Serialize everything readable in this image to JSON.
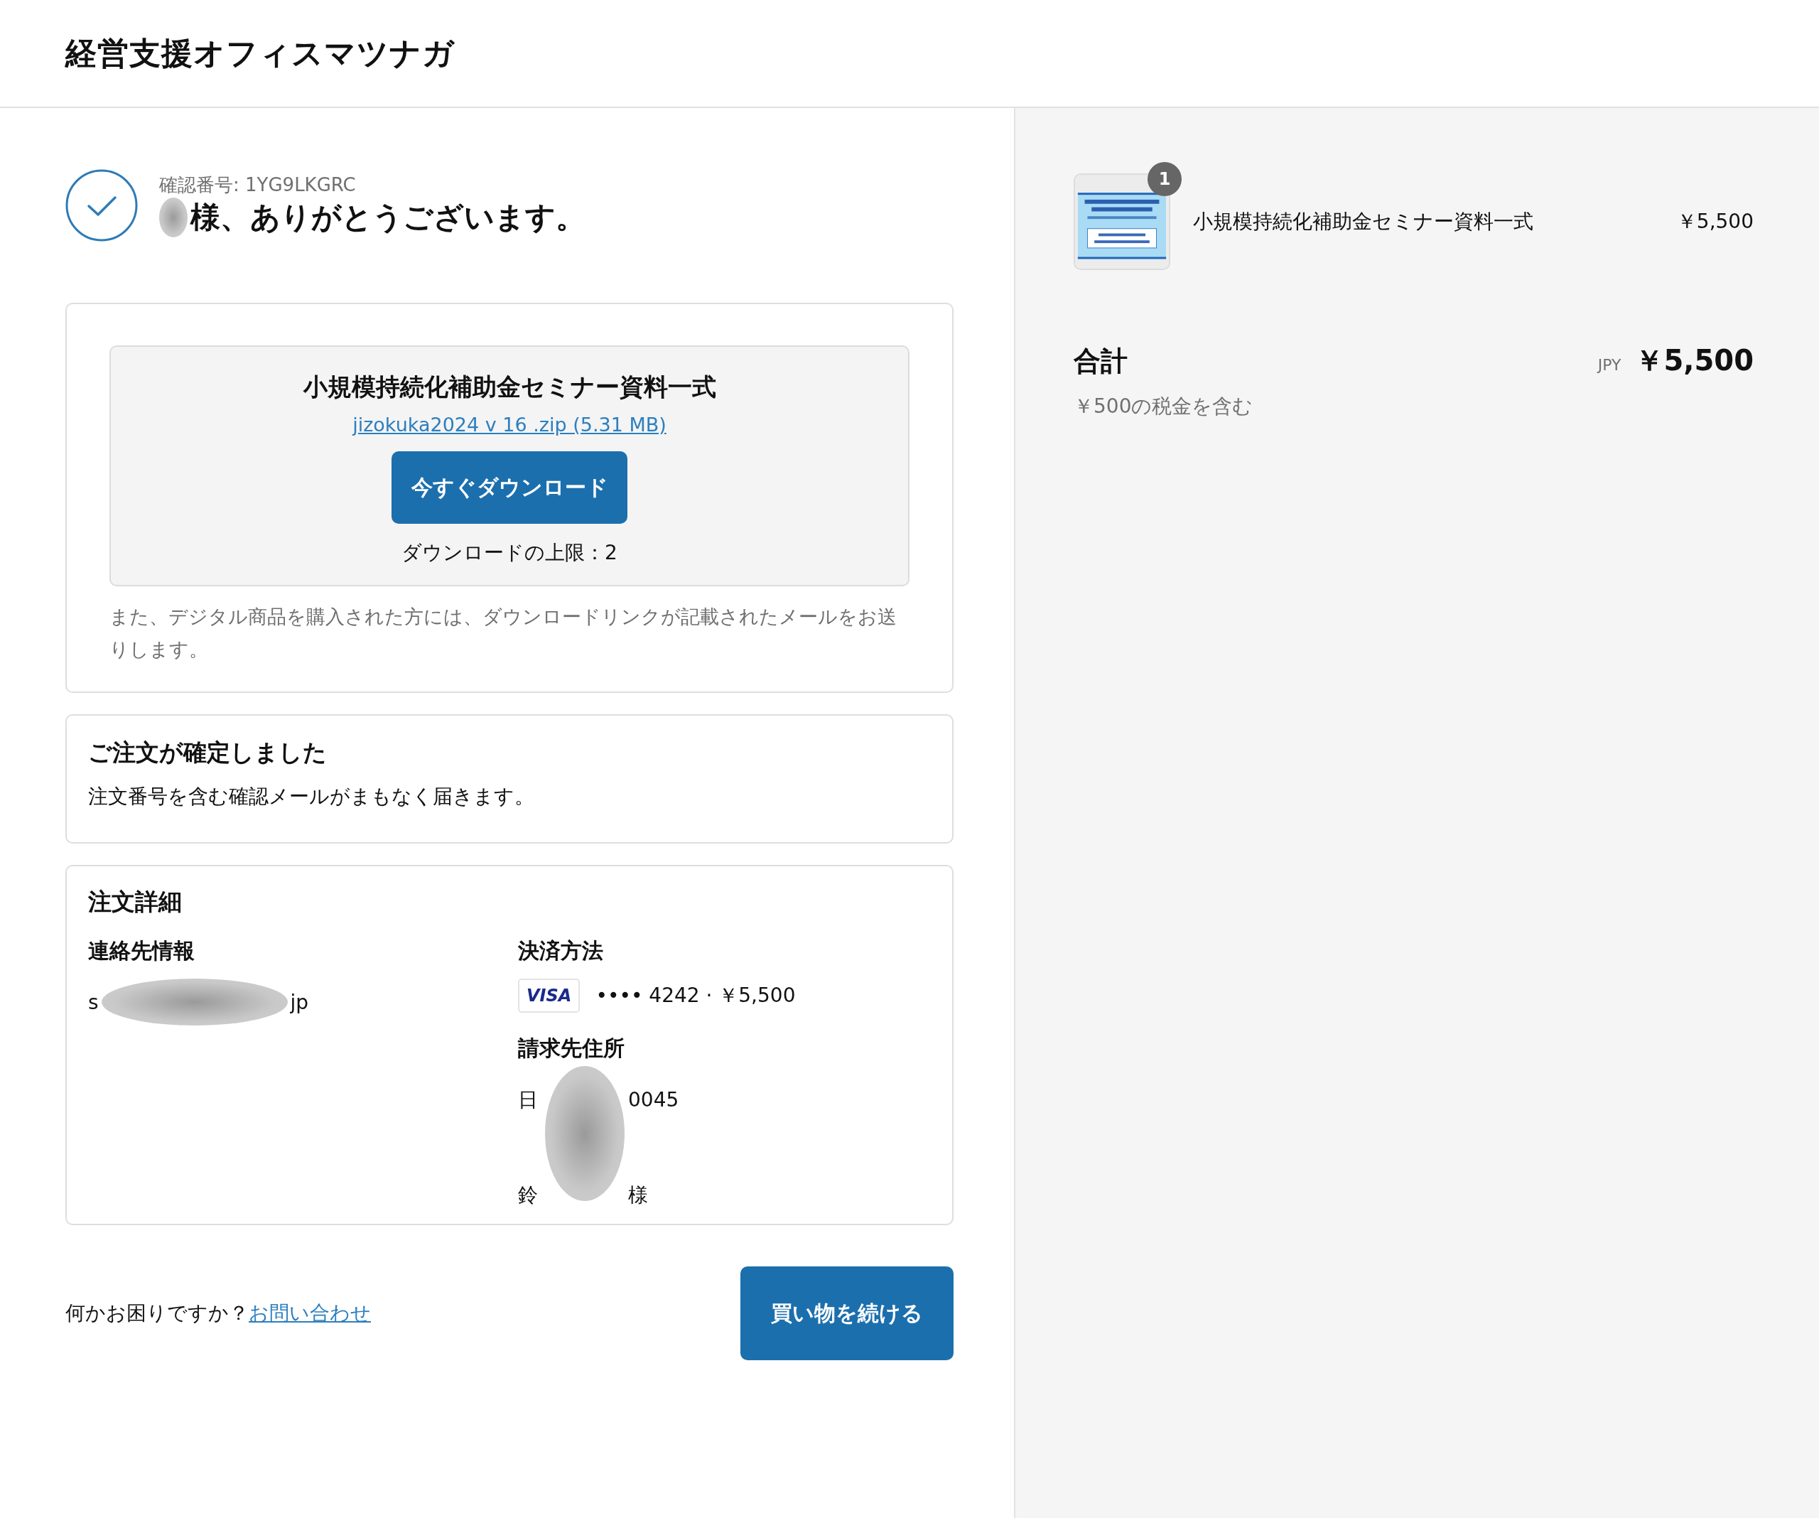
{
  "header": {
    "shop_name": "経営支援オフィスマツナガ"
  },
  "confirmation": {
    "number_label": "確認番号: 1YG9LKGRC",
    "thanks": "様、ありがとうございます。"
  },
  "download": {
    "product_title": "小規模持続化補助金セミナー資料一式",
    "file_link": "jizokuka2024 v 16 .zip (5.31 MB)",
    "button": "今すぐダウンロード",
    "limit": "ダウンロードの上限：2",
    "note": "また、デジタル商品を購入された方には、ダウンロードリンクが記載されたメールをお送りします。"
  },
  "order_status": {
    "heading": "ご注文が確定しました",
    "message": "注文番号を含む確認メールがまもなく届きます。"
  },
  "order_details": {
    "heading": "注文詳細",
    "contact": {
      "label": "連絡先情報",
      "value_parts": [
        "s",
        "jp"
      ]
    },
    "payment": {
      "label": "決済方法",
      "card_brand": "VISA",
      "summary": "•••• 4242 · ￥5,500"
    },
    "billing": {
      "label": "請求先住所",
      "lines": [
        [
          "日",
          "0045"
        ],
        [
          "鈴",
          "様"
        ]
      ]
    }
  },
  "footer": {
    "help_text": "何かお困りですか？",
    "contact_link": "お問い合わせ",
    "continue_button": "買い物を続ける"
  },
  "summary": {
    "items": [
      {
        "quantity": "1",
        "name": "小規模持続化補助金セミナー資料一式",
        "price": "￥5,500"
      }
    ],
    "total_label": "合計",
    "currency": "JPY",
    "total": "￥5,500",
    "tax_note": "￥500の税金を含む"
  }
}
